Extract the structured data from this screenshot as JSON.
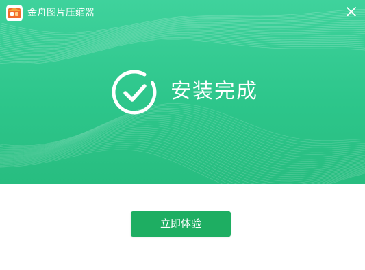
{
  "app": {
    "title": "金舟图片压缩器",
    "logo_icon": "app-logo-icon"
  },
  "window": {
    "close_icon": "close-icon"
  },
  "status": {
    "icon": "check-circle-icon",
    "text": "安装完成"
  },
  "actions": {
    "primary_label": "立即体验"
  },
  "colors": {
    "hero_top": "#3fd29c",
    "hero_bottom": "#28bd80",
    "button": "#1eae62",
    "text_on_hero": "#ffffff"
  }
}
